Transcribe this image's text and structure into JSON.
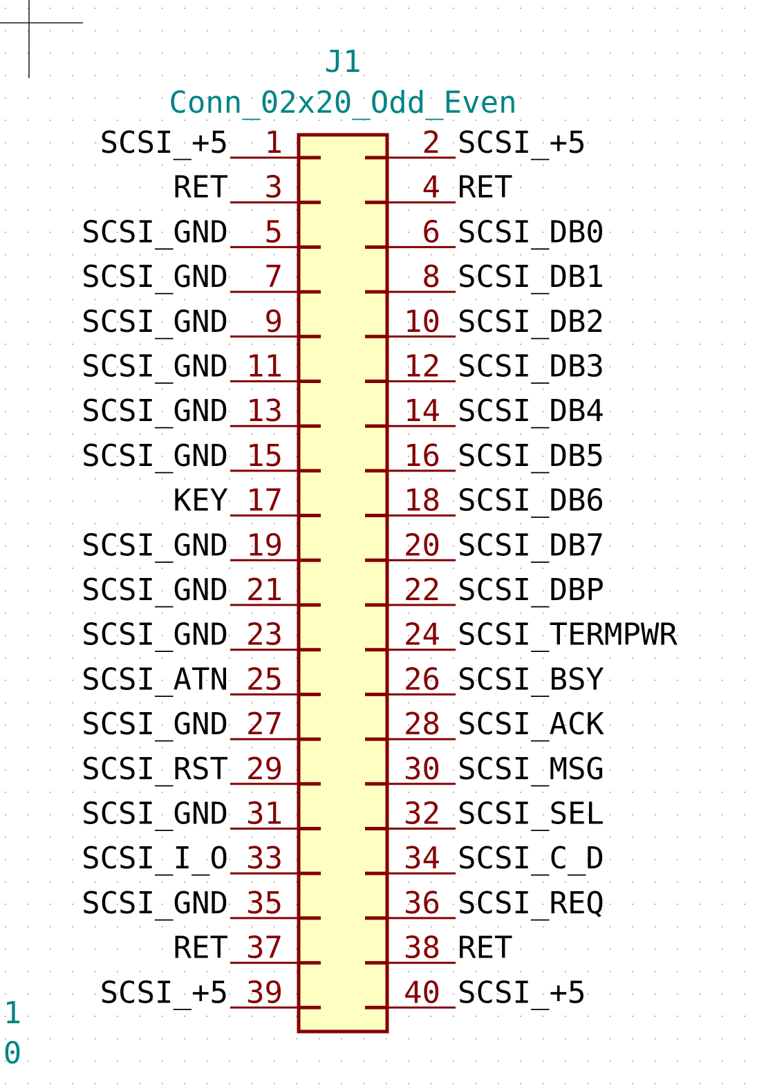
{
  "colors": {
    "background": "#ffffff",
    "grid_dot": "#b8b8b8",
    "body_stroke": "#840000",
    "body_fill": "#ffffc2",
    "pin_line": "#840000",
    "pin_number": "#840000",
    "pin_name": "#000000",
    "reference": "#008484",
    "value": "#008484",
    "cursor": "#1a1a1a",
    "border_label": "#008484"
  },
  "symbol": {
    "reference": "J1",
    "value": "Conn_02x20_Odd_Even",
    "left_pins": [
      {
        "number": "1",
        "name": "SCSI_+5"
      },
      {
        "number": "3",
        "name": "RET"
      },
      {
        "number": "5",
        "name": "SCSI_GND"
      },
      {
        "number": "7",
        "name": "SCSI_GND"
      },
      {
        "number": "9",
        "name": "SCSI_GND"
      },
      {
        "number": "11",
        "name": "SCSI_GND"
      },
      {
        "number": "13",
        "name": "SCSI_GND"
      },
      {
        "number": "15",
        "name": "SCSI_GND"
      },
      {
        "number": "17",
        "name": "KEY"
      },
      {
        "number": "19",
        "name": "SCSI_GND"
      },
      {
        "number": "21",
        "name": "SCSI_GND"
      },
      {
        "number": "23",
        "name": "SCSI_GND"
      },
      {
        "number": "25",
        "name": "SCSI_ATN"
      },
      {
        "number": "27",
        "name": "SCSI_GND"
      },
      {
        "number": "29",
        "name": "SCSI_RST"
      },
      {
        "number": "31",
        "name": "SCSI_GND"
      },
      {
        "number": "33",
        "name": "SCSI_I_O"
      },
      {
        "number": "35",
        "name": "SCSI_GND"
      },
      {
        "number": "37",
        "name": "RET"
      },
      {
        "number": "39",
        "name": "SCSI_+5"
      }
    ],
    "right_pins": [
      {
        "number": "2",
        "name": "SCSI_+5"
      },
      {
        "number": "4",
        "name": "RET"
      },
      {
        "number": "6",
        "name": "SCSI_DB0"
      },
      {
        "number": "8",
        "name": "SCSI_DB1"
      },
      {
        "number": "10",
        "name": "SCSI_DB2"
      },
      {
        "number": "12",
        "name": "SCSI_DB3"
      },
      {
        "number": "14",
        "name": "SCSI_DB4"
      },
      {
        "number": "16",
        "name": "SCSI_DB5"
      },
      {
        "number": "18",
        "name": "SCSI_DB6"
      },
      {
        "number": "20",
        "name": "SCSI_DB7"
      },
      {
        "number": "22",
        "name": "SCSI_DBP"
      },
      {
        "number": "24",
        "name": "SCSI_TERMPWR"
      },
      {
        "number": "26",
        "name": "SCSI_BSY"
      },
      {
        "number": "28",
        "name": "SCSI_ACK"
      },
      {
        "number": "30",
        "name": "SCSI_MSG"
      },
      {
        "number": "32",
        "name": "SCSI_SEL"
      },
      {
        "number": "34",
        "name": "SCSI_C_D"
      },
      {
        "number": "36",
        "name": "SCSI_REQ"
      },
      {
        "number": "38",
        "name": "RET"
      },
      {
        "number": "40",
        "name": "SCSI_+5"
      }
    ]
  },
  "border_labels": [
    "1",
    "0"
  ]
}
